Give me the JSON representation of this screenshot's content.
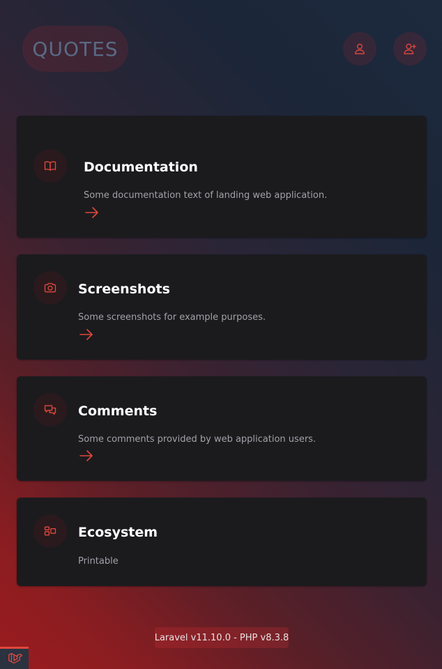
{
  "header": {
    "logo_text": "QUOTES",
    "login_icon": "user-icon",
    "register_icon": "user-plus-icon"
  },
  "colors": {
    "accent": "#e2483d",
    "card_background": "#1b1b1e",
    "muted_text": "#a1a1a8"
  },
  "cards": [
    {
      "icon": "book-open-icon",
      "title": "Documentation",
      "description": "Some documentation text of landing web application.",
      "has_arrow": true
    },
    {
      "icon": "camera-icon",
      "title": "Screenshots",
      "description": "Some screenshots for example purposes.",
      "has_arrow": true
    },
    {
      "icon": "chat-bubbles-icon",
      "title": "Comments",
      "description": "Some comments provided by web application users.",
      "has_arrow": true
    },
    {
      "icon": "layout-blocks-icon",
      "title": "Ecosystem",
      "description": "Printable",
      "has_arrow": false
    }
  ],
  "footer": {
    "version_text": "Laravel v11.10.0 - PHP v8.3.8",
    "debug_icon": "laravel-logo-icon"
  }
}
